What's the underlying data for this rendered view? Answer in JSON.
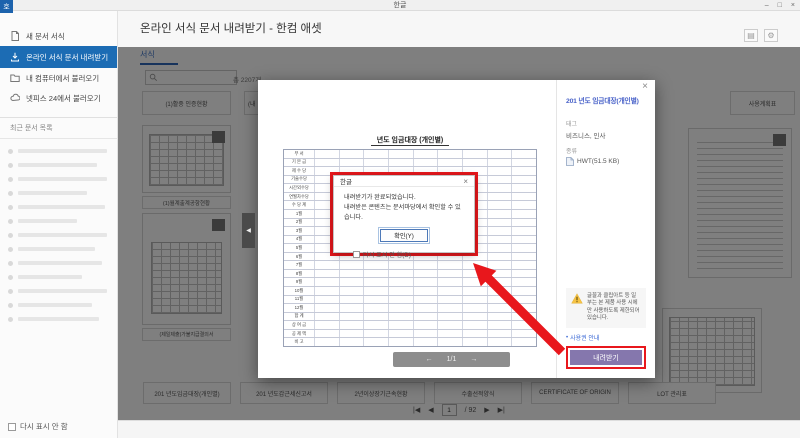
{
  "window": {
    "title": "한글",
    "controls": {
      "min": "–",
      "restore": "□",
      "close": "×"
    }
  },
  "sidebar": {
    "items": [
      {
        "label": "새 문서 서식",
        "icon": "new-document-icon",
        "active": false
      },
      {
        "label": "온라인 서식 문서 내려받기",
        "icon": "download-icon",
        "active": true
      },
      {
        "label": "내 컴퓨터에서 불러오기",
        "icon": "folder-icon",
        "active": false
      },
      {
        "label": "넷피스 24에서 불러오기",
        "icon": "netffice-icon",
        "active": false
      }
    ],
    "recent_header": "최근 문서 목록",
    "recent_placeholder_count": 13,
    "dismiss_checkbox": "다시 표시 안 함"
  },
  "main": {
    "title": "온라인 서식 문서 내려받기 - 한컴 애셋",
    "tab": "서식",
    "total_count": "총 2207개",
    "header_btn1": "▤",
    "header_btn2": "⚙"
  },
  "background": {
    "top_captions": [
      "(1)활중 인증현황",
      "(내",
      "사용계획표"
    ],
    "mid_caption": "(1)월계출계공항현황",
    "form_caption": "(제일제출)가불지급결의서",
    "bottom_captions": [
      "201 년도임금대장(개인별)",
      "201 년도갑근세신고서",
      "2년이상장기근속현황",
      "수출선적양식",
      "CERTIFICATE OF ORIGIN",
      "LOT 관리표"
    ],
    "pager": {
      "first": "|◀",
      "prev": "◀",
      "page": "1",
      "total": "/ 92",
      "next": "▶",
      "last": "▶|"
    }
  },
  "modal": {
    "close": "×",
    "preview": {
      "doc_title": "년도 임금대장 (개인별)",
      "nav_prev": "◀",
      "row_labels": [
        "부  서",
        "기 본 급",
        "제 수 당",
        "기술수당",
        "시간외수당",
        "연월차수당",
        "수 당 계",
        "1월",
        "2월",
        "3월",
        "4월",
        "5월",
        "6월",
        "7월",
        "8월",
        "9월",
        "10월",
        "11월",
        "12월",
        "합  계",
        "상 여 금",
        "공 제 액",
        "비  고"
      ],
      "pager_prev": "←",
      "pager_label": "1/1",
      "pager_next": "→"
    },
    "panel": {
      "title": "201 년도 임금대장(개인별)",
      "tag_label": "태그",
      "tag_value": "비즈니스, 인사",
      "type_label": "종류",
      "type_value": "HWT(51.5 KB)",
      "notice": "글꼴과 클립아트 등 일부는 본 제품 사용 시에만 사용하도록 제한되어 있습니다.",
      "license_bullet": "•",
      "license_link": "사용권 안내",
      "download_button": "내려받기"
    }
  },
  "popup": {
    "title": "한글",
    "close": "×",
    "line1": "내려받기가 완료되었습니다.",
    "line2": "내려받은 콘텐츠는 문서마당에서 확인할 수 있습니다.",
    "confirm": "확인(Y)",
    "checkbox": "다시 표시 안 함(D)"
  },
  "colors": {
    "sidebar_active": "#1c6cb4",
    "panel_title": "#4a63c9",
    "download_purple": "#8577ad",
    "annotation": "#e8171c",
    "link": "#3e6bd6"
  }
}
